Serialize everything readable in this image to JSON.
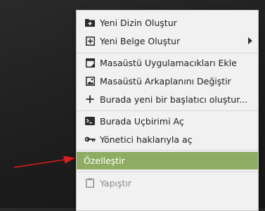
{
  "context_menu": {
    "items": [
      {
        "label": "Yeni Dizin Oluştur",
        "icon": "new-folder-icon"
      },
      {
        "label": "Yeni Belge Oluştur",
        "icon": "new-document-icon",
        "has_submenu": true
      },
      {
        "label": "Masaüstü Uygulamacıkları Ekle",
        "icon": "desklet-icon"
      },
      {
        "label": "Masaüstü Arkaplanını Değiştir",
        "icon": "wallpaper-icon"
      },
      {
        "label": "Burada yeni bir başlatıcı oluştur...",
        "icon": "plus-icon"
      },
      {
        "label": "Burada Uçbirimi Aç",
        "icon": "terminal-icon"
      },
      {
        "label": "Yönetici haklarıyla aç",
        "icon": "key-icon"
      },
      {
        "label": "Özelleştir",
        "icon": "",
        "highlighted": true
      },
      {
        "label": "Yapıştır",
        "icon": "clipboard-icon",
        "disabled": true
      }
    ]
  },
  "colors": {
    "highlight": "#8fac63",
    "annotation_arrow": "#e01b1b"
  }
}
